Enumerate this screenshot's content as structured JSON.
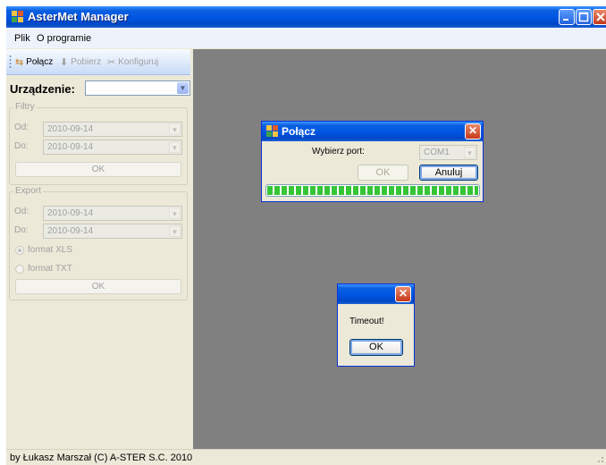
{
  "window": {
    "title": "AsterMet Manager"
  },
  "menu": {
    "items": [
      "Plik",
      "O programie"
    ]
  },
  "toolbar": {
    "connect": "Połącz",
    "fetch": "Pobierz",
    "configure": "Konfiguruj"
  },
  "device": {
    "label": "Urządzenie:",
    "value": ""
  },
  "filters": {
    "title": "Filtry",
    "from_label": "Od:",
    "from_value": "2010-09-14",
    "to_label": "Do:",
    "to_value": "2010-09-14",
    "ok": "OK"
  },
  "export": {
    "title": "Export",
    "from_label": "Od:",
    "from_value": "2010-09-14",
    "to_label": "Do:",
    "to_value": "2010-09-14",
    "format_xls": "format XLS",
    "format_txt": "format TXT",
    "selected_format": "format XLS",
    "ok": "OK"
  },
  "connect_dialog": {
    "title": "Połącz",
    "port_label": "Wybierz port:",
    "port_value": "COM1",
    "ok": "OK",
    "cancel": "Anuluj",
    "progress": 1.0
  },
  "timeout_dialog": {
    "message": "Timeout!",
    "ok": "OK"
  },
  "status": {
    "text": "by Łukasz Marszał (C) A-STER S.C. 2010"
  }
}
